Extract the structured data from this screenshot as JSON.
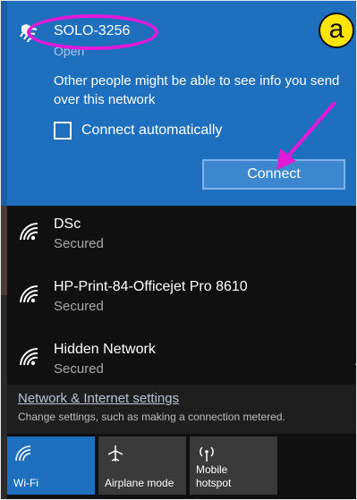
{
  "selected_network": {
    "name": "SOLO-3256",
    "status": "Open",
    "warning": "Other people might be able to see info you send over this network",
    "auto_connect_label": "Connect automatically",
    "auto_connect_checked": false,
    "connect_label": "Connect",
    "icon": "wifi-shield-icon"
  },
  "networks": [
    {
      "name": "DSc",
      "status": "Secured",
      "icon": "wifi-icon"
    },
    {
      "name": "HP-Print-84-Officejet Pro 8610",
      "status": "Secured",
      "icon": "wifi-icon"
    },
    {
      "name": "Hidden Network",
      "status": "Secured",
      "icon": "wifi-icon"
    }
  ],
  "settings": {
    "link_label": "Network & Internet settings",
    "description": "Change settings, such as making a connection metered."
  },
  "quick_actions": [
    {
      "label": "Wi-Fi",
      "icon": "wifi-icon",
      "active": true
    },
    {
      "label": "Airplane mode",
      "icon": "airplane-icon",
      "active": false
    },
    {
      "label": "Mobile hotspot",
      "icon": "hotspot-icon",
      "active": false
    }
  ],
  "annotation": {
    "badge": "a",
    "highlight_color": "#e21ad8",
    "badge_color": "#ffe400"
  },
  "colors": {
    "accent": "#1f6fbf",
    "panel": "#101010",
    "status_text": "#a9a9a9"
  }
}
